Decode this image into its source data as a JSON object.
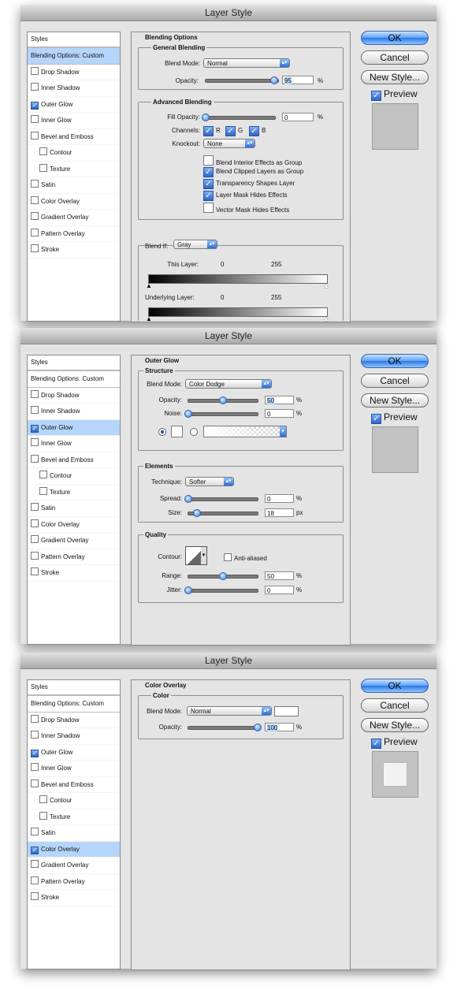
{
  "dialog_title": "Layer Style",
  "buttons": {
    "ok": "OK",
    "cancel": "Cancel",
    "new_style": "New Style...",
    "preview": "Preview"
  },
  "styles_list": {
    "header": "Styles",
    "items": [
      {
        "label": "Blending Options: Custom"
      },
      {
        "label": "Drop Shadow"
      },
      {
        "label": "Inner Shadow"
      },
      {
        "label": "Outer Glow"
      },
      {
        "label": "Inner Glow"
      },
      {
        "label": "Bevel and Emboss"
      },
      {
        "label": "Contour"
      },
      {
        "label": "Texture"
      },
      {
        "label": "Satin"
      },
      {
        "label": "Color Overlay"
      },
      {
        "label": "Gradient Overlay"
      },
      {
        "label": "Pattern Overlay"
      },
      {
        "label": "Stroke"
      }
    ]
  },
  "dialog1": {
    "selected": "Blending Options: Custom",
    "checked": [
      "Outer Glow"
    ],
    "section": "Blending Options",
    "general": {
      "title": "General Blending",
      "blend_mode_label": "Blend Mode:",
      "blend_mode": "Normal",
      "opacity_label": "Opacity:",
      "opacity": "95",
      "opacity_unit": "%"
    },
    "advanced": {
      "title": "Advanced Blending",
      "fill_label": "Fill Opacity:",
      "fill": "0",
      "fill_unit": "%",
      "channels_label": "Channels:",
      "channels": [
        "R",
        "G",
        "B"
      ],
      "knockout_label": "Knockout:",
      "knockout": "None",
      "options": [
        {
          "label": "Blend Interior Effects as Group",
          "checked": false
        },
        {
          "label": "Blend Clipped Layers as Group",
          "checked": true
        },
        {
          "label": "Transparency Shapes Layer",
          "checked": true
        },
        {
          "label": "Layer Mask Hides Effects",
          "checked": true
        },
        {
          "label": "Vector Mask Hides Effects",
          "checked": false
        }
      ]
    },
    "blend_if": {
      "label": "Blend If:",
      "value": "Gray",
      "this_layer": "This Layer:",
      "underlying": "Underlying Layer:",
      "min": "0",
      "max": "255"
    }
  },
  "dialog2": {
    "selected": "Outer Glow",
    "checked": [
      "Outer Glow"
    ],
    "section": "Outer Glow",
    "structure": {
      "title": "Structure",
      "blend_mode_label": "Blend Mode:",
      "blend_mode": "Color Dodge",
      "opacity_label": "Opacity:",
      "opacity": "50",
      "opacity_pct": 50,
      "noise_label": "Noise:",
      "noise": "0",
      "unit": "%"
    },
    "elements": {
      "title": "Elements",
      "technique_label": "Technique:",
      "technique": "Softer",
      "spread_label": "Spread:",
      "spread": "0",
      "spread_unit": "%",
      "size_label": "Size:",
      "size": "18",
      "size_unit": "px"
    },
    "quality": {
      "title": "Quality",
      "contour_label": "Contour:",
      "anti_aliased": "Anti-aliased",
      "range_label": "Range:",
      "range": "50",
      "jitter_label": "Jitter:",
      "jitter": "0",
      "unit": "%"
    }
  },
  "dialog3": {
    "selected": "Color Overlay",
    "checked": [
      "Outer Glow",
      "Color Overlay"
    ],
    "section": "Color Overlay",
    "color": {
      "title": "Color",
      "blend_mode_label": "Blend Mode:",
      "blend_mode": "Normal",
      "opacity_label": "Opacity:",
      "opacity": "100",
      "opacity_unit": "%"
    }
  },
  "colors": {
    "accent": "#3b7bd8",
    "selection": "#b5d5fb",
    "dialog_bg": "#e4e4e4"
  }
}
